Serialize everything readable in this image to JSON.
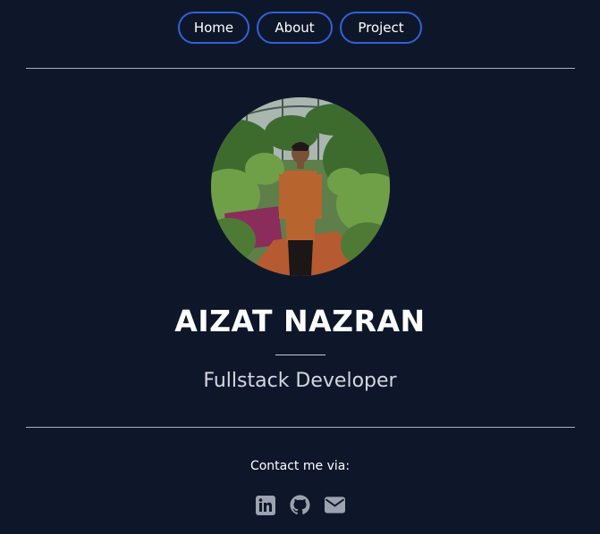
{
  "nav": {
    "home_label": "Home",
    "about_label": "About",
    "project_label": "Project"
  },
  "profile": {
    "name": "AIZAT NAZRAN",
    "role": "Fullstack Developer"
  },
  "contact": {
    "label": "Contact me via:",
    "icons": [
      "linkedin-icon",
      "github-icon",
      "envelope-icon"
    ]
  },
  "colors": {
    "background": "#0e172a",
    "nav_border": "#2f62d9",
    "text": "#ffffff",
    "muted_text": "#d4d7de",
    "divider": "#a9afba",
    "icon": "#9ca3af"
  }
}
